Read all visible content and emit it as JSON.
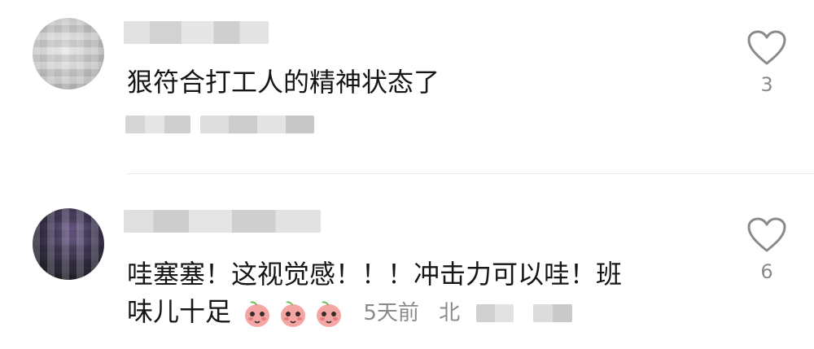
{
  "comments": [
    {
      "text": "狠符合打工人的精神状态了",
      "likes": "3"
    },
    {
      "text_line1": "哇塞塞！这视觉感！！！冲击力可以哇！班",
      "text_line2": "味儿十足",
      "emoji_count": 3,
      "emoji_icon": "peach-emoji-icon",
      "time": "5天前",
      "location_visible": "北",
      "likes": "6"
    }
  ],
  "colors": {
    "text": "#161616",
    "meta": "#8a8a8a",
    "heart_stroke": "#8a8a8a",
    "emoji_peach": "#f3a6a4"
  }
}
